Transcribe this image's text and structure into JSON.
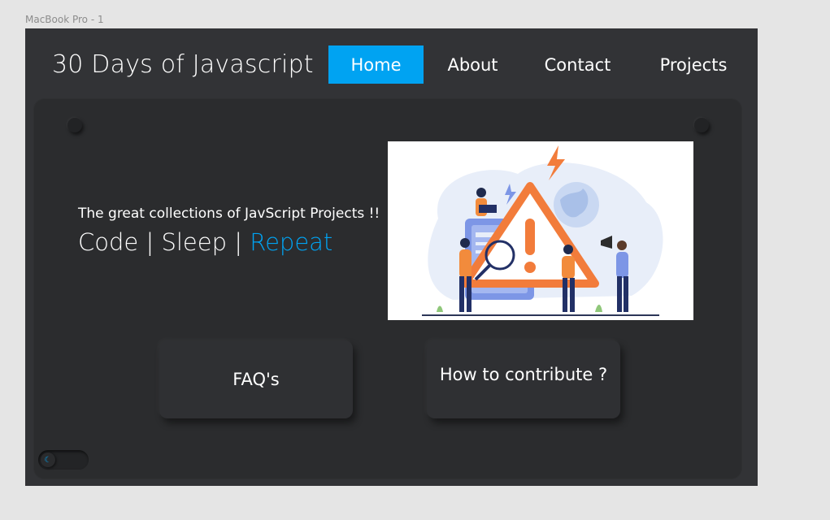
{
  "canvas": {
    "frame_label": "MacBook Pro - 1"
  },
  "header": {
    "brand": "30 Days of Javascript",
    "nav": [
      {
        "label": "Home",
        "active": true
      },
      {
        "label": "About",
        "active": false
      },
      {
        "label": "Contact",
        "active": false
      },
      {
        "label": "Projects",
        "active": false
      }
    ]
  },
  "hero": {
    "tagline": "The great collections of JavScript Projects !!",
    "motto_part1": "Code | Sleep | ",
    "motto_accent": "Repeat",
    "illustration": "warning-sign-illustration"
  },
  "cards": {
    "faq": "FAQ's",
    "contribute": "How to contribute ?"
  },
  "theme_toggle": {
    "icon": "moon-icon"
  },
  "colors": {
    "accent": "#00a3f2",
    "frame_bg": "#323336",
    "panel_bg": "#2b2c2e",
    "text": "#ffffff"
  }
}
